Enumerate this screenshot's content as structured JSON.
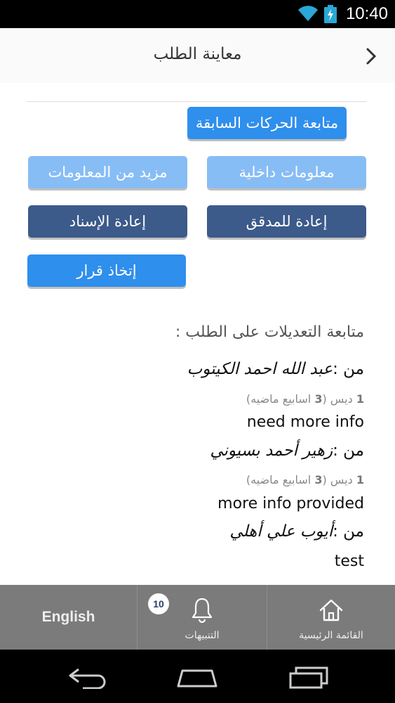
{
  "status_bar": {
    "time": "10:40",
    "wifi_icon": "wifi-icon",
    "battery_icon": "battery-charging-icon"
  },
  "header": {
    "title": "معاينة الطلب",
    "back_icon": "chevron-right-icon"
  },
  "buttons": {
    "track_previous": "متابعة الحركات السابقة",
    "more_info": "مزيد من المعلومات",
    "internal_info": "معلومات داخلية",
    "reassign": "إعادة الإسناد",
    "return_to_auditor": "إعادة للمدقق",
    "take_decision": "إتخاذ قرار"
  },
  "history": {
    "title": "متابعة التعديلات على الطلب :",
    "from_prefix": "من :",
    "entries": [
      {
        "author": "عبد الله احمد الكيتوب",
        "date_day": "1",
        "date_month": "ديس",
        "ago_count": "3",
        "ago_text": "اسابيع ماضيه",
        "comment": "need more info"
      },
      {
        "author": "زهير أحمد بسيوني",
        "date_day": "1",
        "date_month": "ديس",
        "ago_count": "3",
        "ago_text": "اسابيع ماضيه",
        "comment": "more info provided"
      },
      {
        "author": "أيوب علي أهلي",
        "comment": "test"
      }
    ]
  },
  "bottom_nav": {
    "english": "English",
    "alerts_label": "التنبيهات",
    "alerts_badge": "10",
    "alerts_icon": "bell-icon",
    "home_label": "القائمة الرئيسية",
    "home_icon": "home-icon"
  },
  "system_nav": {
    "back_icon": "back-arrow-icon",
    "home_icon": "home-outline-icon",
    "recents_icon": "recents-icon"
  }
}
